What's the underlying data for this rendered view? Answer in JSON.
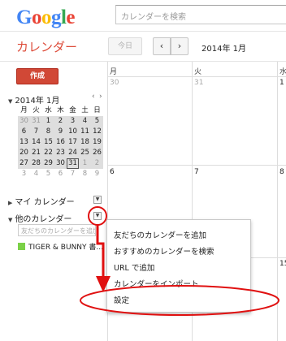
{
  "header": {
    "logo_letters": [
      "G",
      "o",
      "o",
      "g",
      "l",
      "e"
    ],
    "logo_colors": [
      "#4285f4",
      "#ea4335",
      "#fbbc05",
      "#4285f4",
      "#34a853",
      "#ea4335"
    ],
    "search_placeholder": "カレンダーを検索"
  },
  "toolbar": {
    "app_title": "カレンダー",
    "today_label": "今日",
    "prev_icon": "‹",
    "next_icon": "›",
    "current_period": "2014年 1月"
  },
  "sidebar": {
    "create_label": "作成",
    "mini_calendar": {
      "title": "2014年 1月",
      "weekdays": [
        "月",
        "火",
        "水",
        "木",
        "金",
        "土",
        "日"
      ],
      "weeks": [
        [
          "30",
          "31",
          "1",
          "2",
          "3",
          "4",
          "5"
        ],
        [
          "6",
          "7",
          "8",
          "9",
          "10",
          "11",
          "12"
        ],
        [
          "13",
          "14",
          "15",
          "16",
          "17",
          "18",
          "19"
        ],
        [
          "20",
          "21",
          "22",
          "23",
          "24",
          "25",
          "26"
        ],
        [
          "27",
          "28",
          "29",
          "30",
          "31",
          "1",
          "2"
        ],
        [
          "3",
          "4",
          "5",
          "6",
          "7",
          "8",
          "9"
        ]
      ],
      "today": "31"
    },
    "my_calendars_label": "マイ カレンダー",
    "other_calendars_label": "他のカレンダー",
    "add_friend_placeholder": "友だちのカレンダーを追加",
    "calendar_item_label": "TIGER & BUNNY 書...",
    "calendar_item_color": "#7bd148"
  },
  "main": {
    "day_headers": [
      "月",
      "火",
      "水"
    ],
    "week1_dates": [
      "30",
      "31",
      "1"
    ],
    "week2_dates": [
      "6",
      "7",
      "8"
    ],
    "week3_dates": [
      "15"
    ]
  },
  "menu": {
    "items": [
      "友だちのカレンダーを追加",
      "おすすめのカレンダーを検索",
      "URL で追加",
      "カレンダーをインポート",
      "設定"
    ]
  },
  "annotation_color": "#e01010"
}
